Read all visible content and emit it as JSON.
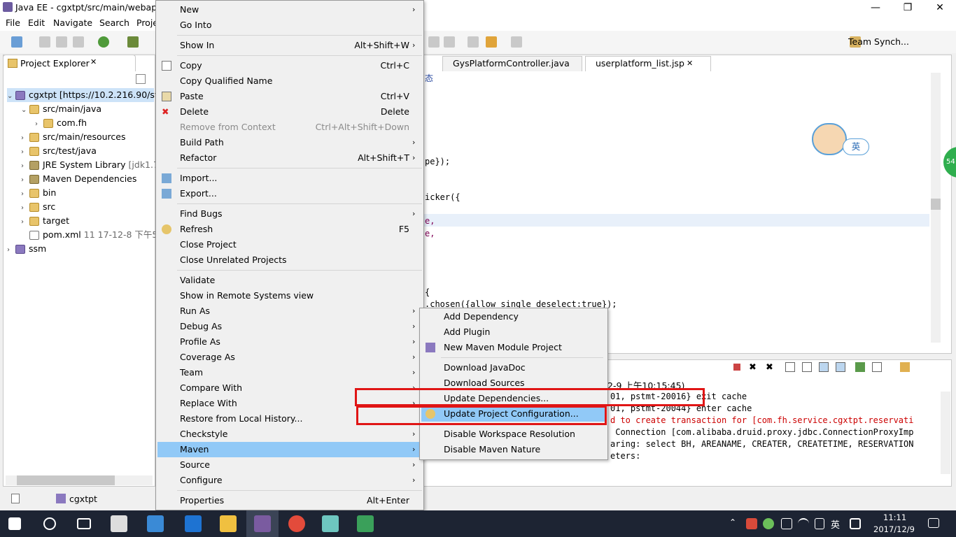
{
  "window": {
    "title": "Java EE - cgxtpt/src/main/webapp",
    "minimize": "—",
    "restore": "❐",
    "close": "✕"
  },
  "menubar": [
    "File",
    "Edit",
    "Navigate",
    "Search",
    "Proje"
  ],
  "toolbar": {
    "perspective": "Team Synch..."
  },
  "project_explorer": {
    "tab": "Project Explorer",
    "tree": [
      {
        "label": "cgxtpt [https://10.2.216.90/svn",
        "twisty": "⌄"
      },
      {
        "label": "src/main/java",
        "twisty": "⌄"
      },
      {
        "label": "com.fh",
        "twisty": "›"
      },
      {
        "label": "src/main/resources",
        "twisty": "›"
      },
      {
        "label": "src/test/java",
        "twisty": "›"
      },
      {
        "label": "JRE System Library",
        "suffix": "[jdk1.7",
        "twisty": "›"
      },
      {
        "label": "Maven Dependencies",
        "twisty": "›"
      },
      {
        "label": "bin",
        "twisty": "›"
      },
      {
        "label": "src",
        "twisty": "›"
      },
      {
        "label": "target",
        "twisty": "›"
      },
      {
        "label": "pom.xml",
        "suffix": "11  17-12-8 下午5",
        "twisty": ""
      },
      {
        "label": "ssm",
        "twisty": "›"
      }
    ]
  },
  "editor": {
    "tabs": [
      "GysPlatformController.java",
      "userplatform_list.jsp"
    ],
    "lines": [
      "态",
      "pe});",
      "icker({",
      "e,",
      "e,",
      "{",
      ".chosen({allow_single_deselect:true});"
    ]
  },
  "console": {
    "header": "2-9 上午10:15:45)",
    "lines": [
      "01, pstmt-20016} exit cache",
      "01, pstmt-20044} enter cache",
      "d to create transaction for [com.fh.service.cgxtpt.reservati",
      " Connection [com.alibaba.druid.proxy.jdbc.ConnectionProxyImp",
      "aring: select BH, AREANAME, CREATER, CREATETIME, RESERVATION",
      "eters:"
    ]
  },
  "status": {
    "selection": "cgxtpt"
  },
  "context_menu": {
    "items": [
      {
        "label": "New",
        "shortcut": "",
        "submenu": true
      },
      {
        "label": "Go Into",
        "shortcut": "",
        "submenu": false
      },
      {
        "label": "Show In",
        "shortcut": "Alt+Shift+W",
        "submenu": true
      },
      {
        "label": "Copy",
        "shortcut": "Ctrl+C",
        "submenu": false
      },
      {
        "label": "Copy Qualified Name",
        "shortcut": "",
        "submenu": false
      },
      {
        "label": "Paste",
        "shortcut": "Ctrl+V",
        "submenu": false
      },
      {
        "label": "Delete",
        "shortcut": "Delete",
        "submenu": false
      },
      {
        "label": "Remove from Context",
        "shortcut": "Ctrl+Alt+Shift+Down",
        "submenu": false,
        "disabled": true
      },
      {
        "label": "Build Path",
        "shortcut": "",
        "submenu": true
      },
      {
        "label": "Refactor",
        "shortcut": "Alt+Shift+T",
        "submenu": true
      },
      {
        "label": "Import...",
        "shortcut": "",
        "submenu": false
      },
      {
        "label": "Export...",
        "shortcut": "",
        "submenu": false
      },
      {
        "label": "Find Bugs",
        "shortcut": "",
        "submenu": true
      },
      {
        "label": "Refresh",
        "shortcut": "F5",
        "submenu": false
      },
      {
        "label": "Close Project",
        "shortcut": "",
        "submenu": false
      },
      {
        "label": "Close Unrelated Projects",
        "shortcut": "",
        "submenu": false
      },
      {
        "label": "Validate",
        "shortcut": "",
        "submenu": false
      },
      {
        "label": "Show in Remote Systems view",
        "shortcut": "",
        "submenu": false
      },
      {
        "label": "Run As",
        "shortcut": "",
        "submenu": true
      },
      {
        "label": "Debug As",
        "shortcut": "",
        "submenu": true
      },
      {
        "label": "Profile As",
        "shortcut": "",
        "submenu": true
      },
      {
        "label": "Coverage As",
        "shortcut": "",
        "submenu": true
      },
      {
        "label": "Team",
        "shortcut": "",
        "submenu": true
      },
      {
        "label": "Compare With",
        "shortcut": "",
        "submenu": true
      },
      {
        "label": "Replace With",
        "shortcut": "",
        "submenu": true
      },
      {
        "label": "Restore from Local History...",
        "shortcut": "",
        "submenu": false
      },
      {
        "label": "Checkstyle",
        "shortcut": "",
        "submenu": true
      },
      {
        "label": "Maven",
        "shortcut": "",
        "submenu": true,
        "selected": true
      },
      {
        "label": "Source",
        "shortcut": "",
        "submenu": true
      },
      {
        "label": "Configure",
        "shortcut": "",
        "submenu": true
      },
      {
        "label": "Properties",
        "shortcut": "Alt+Enter",
        "submenu": false
      }
    ]
  },
  "maven_submenu": {
    "items": [
      {
        "label": "Add Dependency"
      },
      {
        "label": "Add Plugin"
      },
      {
        "label": "New Maven Module Project"
      },
      {
        "label": "Download JavaDoc"
      },
      {
        "label": "Download Sources"
      },
      {
        "label": "Update Dependencies..."
      },
      {
        "label": "Update Project Configuration...",
        "selected": true
      },
      {
        "label": "Disable Workspace Resolution"
      },
      {
        "label": "Disable Maven Nature"
      }
    ]
  },
  "overlay": {
    "ime_label": "英",
    "float_badge": "54"
  },
  "taskbar": {
    "tray_lang": "英",
    "time": "11:11",
    "date": "2017/12/9"
  },
  "colors": {
    "selection": "#91c9f7",
    "annotation": "#e01515",
    "taskbar": "#1d2433"
  }
}
